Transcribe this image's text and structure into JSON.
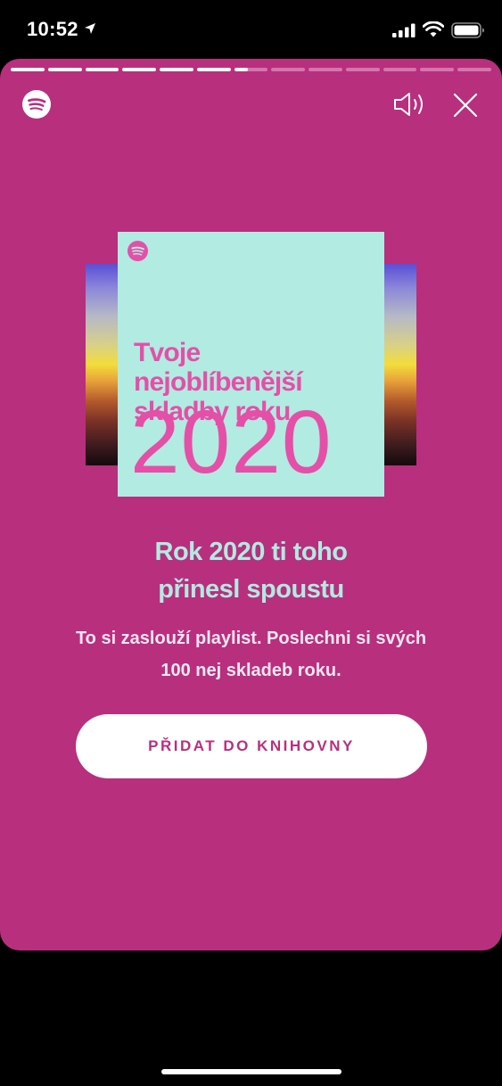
{
  "status_bar": {
    "time": "10:52",
    "icons": [
      "location-arrow-icon",
      "signal-icon",
      "wifi-icon",
      "battery-icon"
    ]
  },
  "story": {
    "progress": {
      "total_segments": 13,
      "completed_segments": 6.4
    },
    "header_icons": [
      "spotify-logo",
      "volume-icon",
      "close-icon"
    ],
    "cover": {
      "title": "Tvoje nejoblíbenější skladby roku",
      "year": "2020"
    },
    "headline_line1": "Rok 2020 ti toho",
    "headline_line2": "přinesl spoustu",
    "subtext_line1": "To si zaslouží playlist. Poslechni si svých",
    "subtext_line2": "100 nej skladeb roku.",
    "button_label": "PŘIDAT DO KNIHOVNY"
  },
  "colors": {
    "background": "#000000",
    "card": "#b82f7e",
    "cover_bg": "#b1ebe1",
    "cover_text": "#e54fa8",
    "headline": "#b1ebe1",
    "button_bg": "#ffffff",
    "button_text": "#b82f7e"
  }
}
